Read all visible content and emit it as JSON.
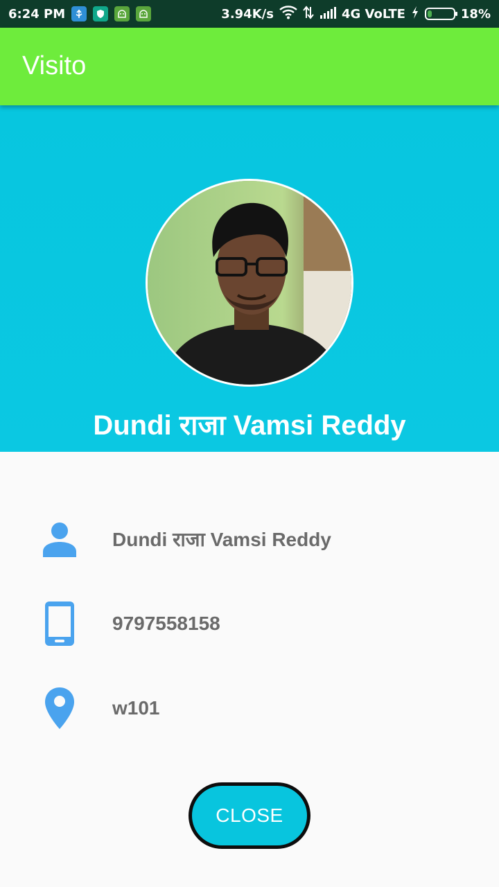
{
  "status_bar": {
    "time": "6:24 PM",
    "network_speed": "3.94K/s",
    "network_type": "4G VoLTE",
    "battery_percent": "18%",
    "battery_level": 0.18,
    "icons": [
      "usb-icon",
      "shield-icon",
      "android-icon",
      "android-icon",
      "wifi-icon",
      "data-arrows-icon",
      "signal-icon",
      "charging-icon",
      "battery-icon"
    ]
  },
  "app_bar": {
    "title": "Visito",
    "color": "#6eec3c"
  },
  "profile": {
    "name": "Dundi राजा Vamsi Reddy",
    "hero_color": "#07c6df"
  },
  "details": {
    "name": "Dundi राजा Vamsi Reddy",
    "phone": "9797558158",
    "location": "w101",
    "icon_color": "#4aa3ee"
  },
  "actions": {
    "close_label": "CLOSE"
  }
}
